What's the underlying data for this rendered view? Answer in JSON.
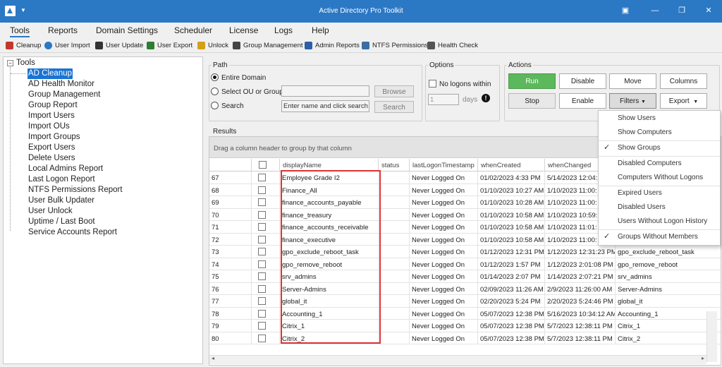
{
  "window": {
    "title": "Active Directory Pro Toolkit",
    "min_icon": "minimize-icon",
    "restore_icon": "restore-icon",
    "close_icon": "close-icon"
  },
  "menu": {
    "items": [
      "Tools",
      "Reports",
      "Domain Settings",
      "Scheduler",
      "License",
      "Logs",
      "Help"
    ],
    "active": "Tools"
  },
  "toolbar": {
    "items": [
      {
        "label": "Cleanup",
        "icon": "cleanup-icon",
        "color": "#c0392b"
      },
      {
        "label": "User Import",
        "icon": "info-icon",
        "color": "#2b78c5"
      },
      {
        "label": "User Update",
        "icon": "user-update-icon",
        "color": "#333333"
      },
      {
        "label": "User Export",
        "icon": "user-export-icon",
        "color": "#2e7d32"
      },
      {
        "label": "Unlock",
        "icon": "unlock-icon",
        "color": "#d4a017"
      },
      {
        "label": "Group Management",
        "icon": "group-icon",
        "color": "#444444"
      },
      {
        "label": "Admin Reports",
        "icon": "admin-reports-icon",
        "color": "#2b5fa8"
      },
      {
        "label": "NTFS Permissions",
        "icon": "ntfs-icon",
        "color": "#3a6ea5"
      },
      {
        "label": "Health Check",
        "icon": "health-check-icon",
        "color": "#555555"
      }
    ]
  },
  "tree": {
    "root": "Tools",
    "items": [
      "AD Cleanup",
      "AD Health Monitor",
      "Group Management",
      "Group Report",
      "Import Users",
      "Import OUs",
      "Import Groups",
      "Export Users",
      "Delete Users",
      "Local Admins Report",
      "Last Logon Report",
      "NTFS Permissions Report",
      "User Bulk Updater",
      "User Unlock",
      "Uptime / Last Boot",
      "Service Accounts Report"
    ],
    "selected": "AD Cleanup"
  },
  "path": {
    "label": "Path",
    "entire_domain": "Entire Domain",
    "select_ou": "Select OU or Group",
    "search": "Search",
    "browse": "Browse",
    "search_btn": "Search",
    "search_placeholder": "Enter name and click search"
  },
  "options": {
    "label": "Options",
    "no_logons": "No logons within",
    "days_value": "1",
    "days_label": "days",
    "warning_icon": "warning-icon"
  },
  "actions": {
    "label": "Actions",
    "run": "Run",
    "disable": "Disable",
    "move": "Move",
    "columns": "Columns",
    "stop": "Stop",
    "enable": "Enable",
    "filters": "Filters",
    "export": "Export",
    "run_color": "#5cb85c"
  },
  "filters_menu": {
    "items": [
      "Show Users",
      "Show Computers",
      "Show Groups",
      "Disabled Computers",
      "Computers Without Logons",
      "Expired Users",
      "Disabled Users",
      "Users Without Logon History",
      "Groups Without Members"
    ],
    "checked": [
      "Show Groups",
      "Groups Without Members"
    ]
  },
  "results": {
    "label": "Results",
    "group_hint": "Drag a column header to group by that column",
    "columns": [
      "",
      "",
      "displayName",
      "status",
      "lastLogonTimestamp",
      "whenCreated",
      "whenChanged",
      ""
    ],
    "rows": [
      [
        "67",
        "Employee Grade I2",
        "",
        "Never Logged On",
        "01/02/2023 4:33 PM",
        "5/14/2023 12:04:",
        "",
        ""
      ],
      [
        "68",
        "Finance_All",
        "",
        "Never Logged On",
        "01/10/2023 10:27 AM",
        "1/10/2023 11:00:",
        "",
        ""
      ],
      [
        "69",
        "finance_accounts_payable",
        "",
        "Never Logged On",
        "01/10/2023 10:28 AM",
        "1/10/2023 11:00:",
        "",
        ""
      ],
      [
        "70",
        "finance_treasury",
        "",
        "Never Logged On",
        "01/10/2023 10:58 AM",
        "1/10/2023 10:59:",
        "",
        ""
      ],
      [
        "71",
        "finance_accounts_receivable",
        "",
        "Never Logged On",
        "01/10/2023 10:58 AM",
        "1/10/2023 11:01:",
        "",
        ""
      ],
      [
        "72",
        "finance_executive",
        "",
        "Never Logged On",
        "01/10/2023 10:58 AM",
        "1/10/2023 11:00:",
        "",
        ""
      ],
      [
        "73",
        "gpo_exclude_reboot_task",
        "",
        "Never Logged On",
        "01/12/2023 12:31 PM",
        "1/12/2023 12:31:23 PM",
        "gpo_exclude_reboot_task",
        ""
      ],
      [
        "74",
        "gpo_remove_reboot",
        "",
        "Never Logged On",
        "01/12/2023 1:57 PM",
        "1/12/2023 2:01:08 PM",
        "gpo_remove_reboot",
        ""
      ],
      [
        "75",
        "srv_admins",
        "",
        "Never Logged On",
        "01/14/2023 2:07 PM",
        "1/14/2023 2:07:21 PM",
        "srv_admins",
        ""
      ],
      [
        "76",
        "Server-Admins",
        "",
        "Never Logged On",
        "02/09/2023 11:26 AM",
        "2/9/2023 11:26:00 AM",
        "Server-Admins",
        ""
      ],
      [
        "77",
        "global_it",
        "",
        "Never Logged On",
        "02/20/2023 5:24 PM",
        "2/20/2023 5:24:46 PM",
        "global_it",
        ""
      ],
      [
        "78",
        "Accounting_1",
        "",
        "Never Logged On",
        "05/07/2023 12:38 PM",
        "5/16/2023 10:34:12 AM",
        "Accounting_1",
        ""
      ],
      [
        "79",
        "Citrix_1",
        "",
        "Never Logged On",
        "05/07/2023 12:38 PM",
        "5/7/2023 12:38:11 PM",
        "Citrix_1",
        ""
      ],
      [
        "80",
        "Citrix_2",
        "",
        "Never Logged On",
        "05/07/2023 12:38 PM",
        "5/7/2023 12:38:11 PM",
        "Citrix_2",
        ""
      ]
    ]
  }
}
